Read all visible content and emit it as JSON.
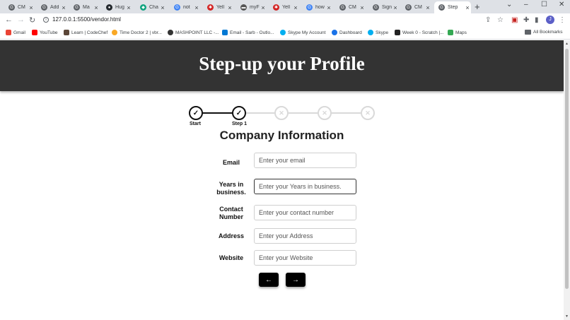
{
  "browser": {
    "tabs": [
      {
        "title": "CM",
        "color": "#5f6368",
        "glyph": "G"
      },
      {
        "title": "Add",
        "color": "#5f6368",
        "glyph": "G"
      },
      {
        "title": "Ma",
        "color": "#5f6368",
        "glyph": "G"
      },
      {
        "title": "Hug",
        "color": "#24292e",
        "glyph": "●"
      },
      {
        "title": "Cha",
        "color": "#10a37f",
        "glyph": "◆"
      },
      {
        "title": "not",
        "color": "#4285f4",
        "glyph": "G"
      },
      {
        "title": "Yell",
        "color": "#d32323",
        "glyph": "✱"
      },
      {
        "title": "myF",
        "color": "#555555",
        "glyph": "▬"
      },
      {
        "title": "Yell",
        "color": "#d32323",
        "glyph": "✱"
      },
      {
        "title": "how",
        "color": "#4285f4",
        "glyph": "G"
      },
      {
        "title": "CM",
        "color": "#5f6368",
        "glyph": "G"
      },
      {
        "title": "Sign",
        "color": "#5f6368",
        "glyph": "G"
      },
      {
        "title": "CM",
        "color": "#5f6368",
        "glyph": "G"
      },
      {
        "title": "Step",
        "color": "#5f6368",
        "glyph": "G",
        "active": true
      }
    ],
    "new_tab": "+",
    "url": "127.0.0.1:5500/vendor.html",
    "profile_initial": "J",
    "bookmarks": [
      {
        "label": "Gmail",
        "color": "#ea4335"
      },
      {
        "label": "YouTube",
        "color": "#ff0000"
      },
      {
        "label": "Learn | CodeChef",
        "color": "#5b4638"
      },
      {
        "label": "Time Doctor 2 | vbr...",
        "color": "#f9a825"
      },
      {
        "label": "MASHPOINT LLC -...",
        "color": "#333333"
      },
      {
        "label": "Email - Sarb - Outlo...",
        "color": "#0078d4"
      },
      {
        "label": "Skype My Account",
        "color": "#00aff0"
      },
      {
        "label": "Dashboard",
        "color": "#1a73e8"
      },
      {
        "label": "Skype",
        "color": "#00aff0"
      },
      {
        "label": "Week 0 - Scratch |...",
        "color": "#222222"
      },
      {
        "label": "Maps",
        "color": "#34a853"
      }
    ],
    "all_bookmarks": "All Bookmarks"
  },
  "page": {
    "header_title": "Step-up your Profile",
    "steps": [
      {
        "label": "Start",
        "status": "done"
      },
      {
        "label": "Step 1",
        "status": "done"
      },
      {
        "label": "",
        "status": "todo"
      },
      {
        "label": "",
        "status": "todo"
      },
      {
        "label": "",
        "status": "todo"
      }
    ],
    "section_title": "Company Information",
    "fields": [
      {
        "label": "Email",
        "placeholder": "Enter your email"
      },
      {
        "label": "Years in business.",
        "placeholder": "Enter your Years in business."
      },
      {
        "label": "Contact Number",
        "placeholder": "Enter your contact number"
      },
      {
        "label": "Address",
        "placeholder": "Enter your Address"
      },
      {
        "label": "Website",
        "placeholder": "Enter your Website"
      }
    ],
    "prev_icon": "←",
    "next_icon": "→",
    "accent_color": "#000000",
    "header_bg": "#333333"
  }
}
